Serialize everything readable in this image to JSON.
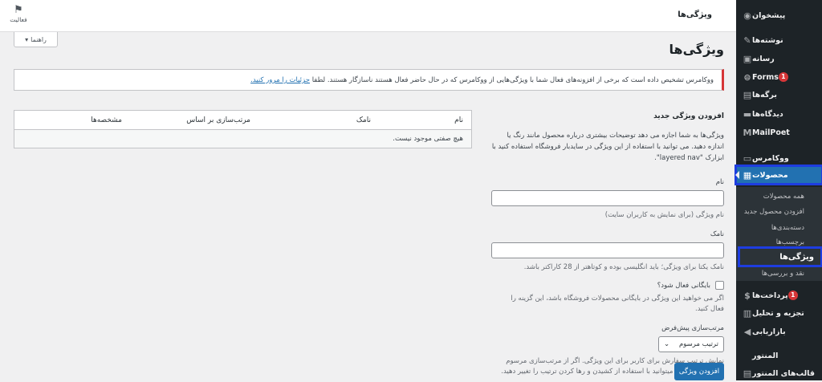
{
  "sidebar": {
    "items": [
      {
        "label": "پیشخوان",
        "icon": "dashboard-icon",
        "glyph": "◉"
      },
      {
        "label": "نوشته‌ها",
        "icon": "pin-icon",
        "glyph": "✎"
      },
      {
        "label": "رسانه",
        "icon": "media-icon",
        "glyph": "▣"
      },
      {
        "label": "Forms",
        "icon": "forms-icon",
        "glyph": "⊜",
        "badge": "1"
      },
      {
        "label": "برگه‌ها",
        "icon": "pages-icon",
        "glyph": "▤"
      },
      {
        "label": "دیدگاه‌ها",
        "icon": "comments-icon",
        "glyph": "▬"
      },
      {
        "label": "MailPoet",
        "icon": "mailpoet-icon",
        "glyph": "M"
      },
      {
        "label": "ووکامرس",
        "icon": "woocommerce-icon",
        "glyph": "▭"
      },
      {
        "label": "محصولات",
        "icon": "products-icon",
        "glyph": "▦"
      },
      {
        "label": "پرداخت‌ها",
        "icon": "payments-icon",
        "glyph": "$",
        "badge": "1"
      },
      {
        "label": "تجزیه و تحلیل",
        "icon": "analytics-icon",
        "glyph": "▥"
      },
      {
        "label": "بازاریابی",
        "icon": "marketing-icon",
        "glyph": "◀"
      },
      {
        "label": "المنتور",
        "icon": "elementor-icon",
        "glyph": ""
      },
      {
        "label": "قالب‌های المنتور",
        "icon": "templates-icon",
        "glyph": "▤"
      }
    ],
    "submenu": [
      "همه محصولات",
      "افزودن محصول جدید",
      "دسته‌بندی‌ها",
      "برچسب‌ها",
      "ویژگی‌ها",
      "نقد و بررسی‌ها"
    ]
  },
  "topbar": {
    "title": "ویژگی‌ها",
    "activity_label": "فعالیت",
    "help_label": "راهنما"
  },
  "page": {
    "title": "ویژگی‌ها"
  },
  "notice": {
    "text": "ووکامرس تشخیص داده است که برخی از افزونه‌های فعال شما با ویژگی‌هایی از ووکامرس که در حال حاضر فعال هستند ناسازگار هستند. لطفا",
    "link": "جزئیات را مرور کنید."
  },
  "form": {
    "title": "افزودن ویژگی جدید",
    "intro": "ویژگی‌ها به شما اجازه می دهد توضیحات بیشتری درباره محصول مانند رنگ یا اندازه دهید. می توانید با استفاده از این ویژگی در ساید‌بار فروشگاه استفاده کنید با ابزارک \"layered nav\".",
    "name_label": "نام",
    "name_desc": "نام ویژگی (برای نمایش به کاربران سایت)",
    "slug_label": "نامک",
    "slug_desc": "نامک یکتا برای ویژگی؛ باید انگلیسی بوده و کوتاهتر از 28 کاراکتر باشد.",
    "archive_label": "بایگانی فعال شود؟",
    "archive_desc": "اگر می خواهید این ویژگی در بایگانی محصولات فروشگاه باشد، این گزینه را فعال کنید.",
    "sort_label": "مرتب‌سازی پیش‌فرض",
    "sort_value": "ترتیب مرسوم",
    "sort_desc": "نمایش ترتیب سفارش برای کاربر برای این ویژگی. اگر از مرتب‌سازی مرسوم استفاده کنید شما میتوانید با استفاده از کشیدن و رها کردن ترتیب را تغییر دهید.",
    "submit_label": "افزودن ویژگی"
  },
  "table": {
    "headers": [
      "نام",
      "نامک",
      "مرتب‌سازی بر اساس",
      "مشخصه‌ها"
    ],
    "empty_text": "هیچ صفتی موجود نیست."
  }
}
